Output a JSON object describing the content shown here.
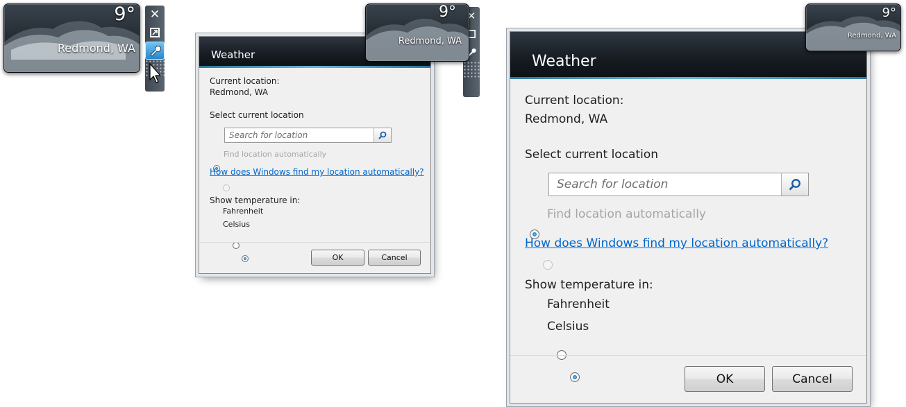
{
  "gadget": {
    "temperature": "9°",
    "location": "Redmond, WA",
    "toolbar_icons": [
      "close-icon",
      "size-toggle-icon",
      "options-wrench-icon",
      "drag-grip-icon"
    ]
  },
  "dialog": {
    "title": "Weather",
    "current_location_label": "Current location:",
    "current_location_value": "Redmond, WA",
    "select_location_label": "Select current location",
    "search_placeholder": "Search for location",
    "find_auto_label": "Find location automatically",
    "help_link": "How does Windows find my location automatically?",
    "temp_unit_label": "Show temperature in:",
    "options": [
      "Fahrenheit",
      "Celsius"
    ],
    "selected_unit": "Celsius",
    "ok_label": "OK",
    "cancel_label": "Cancel"
  },
  "colors": {
    "accent": "#1d7fc6",
    "link": "#0066cc",
    "header": "#161b21",
    "dialog_bg": "#f0f0f0"
  }
}
